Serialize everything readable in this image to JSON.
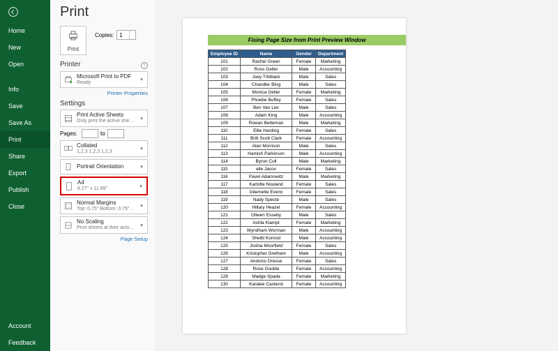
{
  "sidebar": {
    "top": [
      {
        "label": "Home"
      },
      {
        "label": "New"
      },
      {
        "label": "Open"
      }
    ],
    "mid": [
      {
        "label": "Info"
      },
      {
        "label": "Save"
      },
      {
        "label": "Save As"
      },
      {
        "label": "Print"
      },
      {
        "label": "Share"
      },
      {
        "label": "Export"
      },
      {
        "label": "Publish"
      },
      {
        "label": "Close"
      }
    ],
    "bottom": [
      {
        "label": "Account"
      },
      {
        "label": "Feedback"
      }
    ]
  },
  "pane": {
    "title": "Print",
    "print_btn": "Print",
    "copies_label": "Copies:",
    "copies_value": "1",
    "printer_head": "Printer",
    "printer": {
      "title": "Microsoft Print to PDF",
      "sub": "Ready"
    },
    "printer_props": "Printer Properties",
    "settings_head": "Settings",
    "active_sheets": {
      "title": "Print Active Sheets",
      "sub": "Only print the active sheets"
    },
    "pages_label": "Pages:",
    "pages_to": "to",
    "collated": {
      "title": "Collated",
      "sub": "1,2,3   1,2,3   1,2,3"
    },
    "orientation": {
      "title": "Portrait Orientation",
      "sub": ""
    },
    "paper": {
      "title": "A4",
      "sub": "8.27\" x 11.69\""
    },
    "margins": {
      "title": "Normal Margins",
      "sub": "Top: 0.75\" Bottom: 0.75\" Lef…"
    },
    "scaling": {
      "title": "No Scaling",
      "sub": "Print sheets at their actual size"
    },
    "page_setup": "Page Setup"
  },
  "preview": {
    "title": "Fixing Page Size from Print Preview Window",
    "headers": [
      "Employee ID",
      "Name",
      "Gender",
      "Department"
    ],
    "rows": [
      [
        "101",
        "Rachel Green",
        "Female",
        "Marketing"
      ],
      [
        "102",
        "Ross Geller",
        "Male",
        "Accounting"
      ],
      [
        "103",
        "Joey Tribbiani",
        "Male",
        "Sales"
      ],
      [
        "104",
        "Chandler Bing",
        "Male",
        "Sales"
      ],
      [
        "105",
        "Monica Geller",
        "Female",
        "Marketing"
      ],
      [
        "106",
        "Phoebe Buffey",
        "Female",
        "Sales"
      ],
      [
        "107",
        "Ben Van Lier",
        "Male",
        "Sales"
      ],
      [
        "108",
        "Adam King",
        "Male",
        "Accounting"
      ],
      [
        "109",
        "Rowan Betteman",
        "Male",
        "Marketing"
      ],
      [
        "110",
        "Ellie Harding",
        "Female",
        "Sales"
      ],
      [
        "111",
        "Britt Scott Clark",
        "Female",
        "Accounting"
      ],
      [
        "112",
        "Alan Morrison",
        "Male",
        "Sales"
      ],
      [
        "113",
        "Hamish Parkinson",
        "Male",
        "Accounting"
      ],
      [
        "114",
        "Byron Coll",
        "Male",
        "Marketing"
      ],
      [
        "115",
        "elle Jacov",
        "Female",
        "Sales"
      ],
      [
        "116",
        "Pavel Adamowitz",
        "Male",
        "Marketing"
      ],
      [
        "117",
        "Karlotte Nouland",
        "Female",
        "Sales"
      ],
      [
        "118",
        "Gilemette Everix",
        "Female",
        "Sales"
      ],
      [
        "119",
        "Nady Specte",
        "Male",
        "Sales"
      ],
      [
        "120",
        "Hillary Heazel",
        "Female",
        "Accounting"
      ],
      [
        "121",
        "Oliwen Esseby",
        "Male",
        "Sales"
      ],
      [
        "122",
        "Ashla Klampt",
        "Female",
        "Marketing"
      ],
      [
        "123",
        "Wyndham Worman",
        "Male",
        "Accounting"
      ],
      [
        "124",
        "Shelbi Konrod",
        "Male",
        "Accounting"
      ],
      [
        "125",
        "Joshia Moorfield",
        "Female",
        "Sales"
      ],
      [
        "126",
        "Kristopher Gretham",
        "Male",
        "Accounting"
      ],
      [
        "127",
        "Andonis Dresse",
        "Female",
        "Sales"
      ],
      [
        "128",
        "Rose Gooble",
        "Female",
        "Accounting"
      ],
      [
        "129",
        "Madge Spada",
        "Female",
        "Marketing"
      ],
      [
        "130",
        "Karalee Casterot",
        "Female",
        "Accounting"
      ]
    ]
  }
}
